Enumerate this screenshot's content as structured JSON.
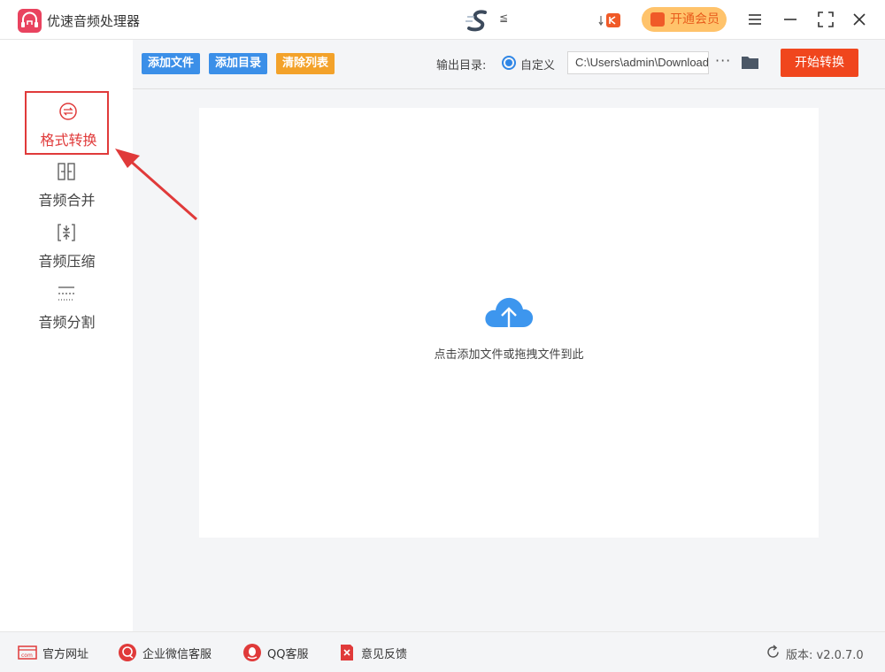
{
  "app": {
    "title": "优速音频处理器",
    "vip_label": "开通会员",
    "accent": "#e03a3a",
    "primary_blue": "#3b8fe8",
    "start_color": "#f0461d"
  },
  "titlebar": {
    "speed_arrows": "≦",
    "controls": [
      "menu-icon",
      "minimize-icon",
      "maximize-icon",
      "close-icon"
    ]
  },
  "sidebar": {
    "items": [
      {
        "label": "格式转换",
        "icon": "format-convert-icon",
        "active": true
      },
      {
        "label": "音频合并",
        "icon": "audio-merge-icon",
        "active": false
      },
      {
        "label": "音频压缩",
        "icon": "audio-compress-icon",
        "active": false
      },
      {
        "label": "音频分割",
        "icon": "audio-split-icon",
        "active": false
      }
    ]
  },
  "toolbar": {
    "add_file": "添加文件",
    "add_dir": "添加目录",
    "clear_list": "清除列表",
    "output_label": "输出目录:",
    "radio_label": "自定义",
    "output_path": "C:\\Users\\admin\\Downloads",
    "more": "···",
    "start": "开始转换"
  },
  "dropzone": {
    "hint": "点击添加文件或拖拽文件到此"
  },
  "footer": {
    "links": [
      {
        "label": "官方网址",
        "icon": "website-icon"
      },
      {
        "label": "企业微信客服",
        "icon": "wechat-service-icon"
      },
      {
        "label": "QQ客服",
        "icon": "qq-icon"
      },
      {
        "label": "意见反馈",
        "icon": "feedback-icon"
      }
    ],
    "version": "版本: v2.0.7.0"
  }
}
